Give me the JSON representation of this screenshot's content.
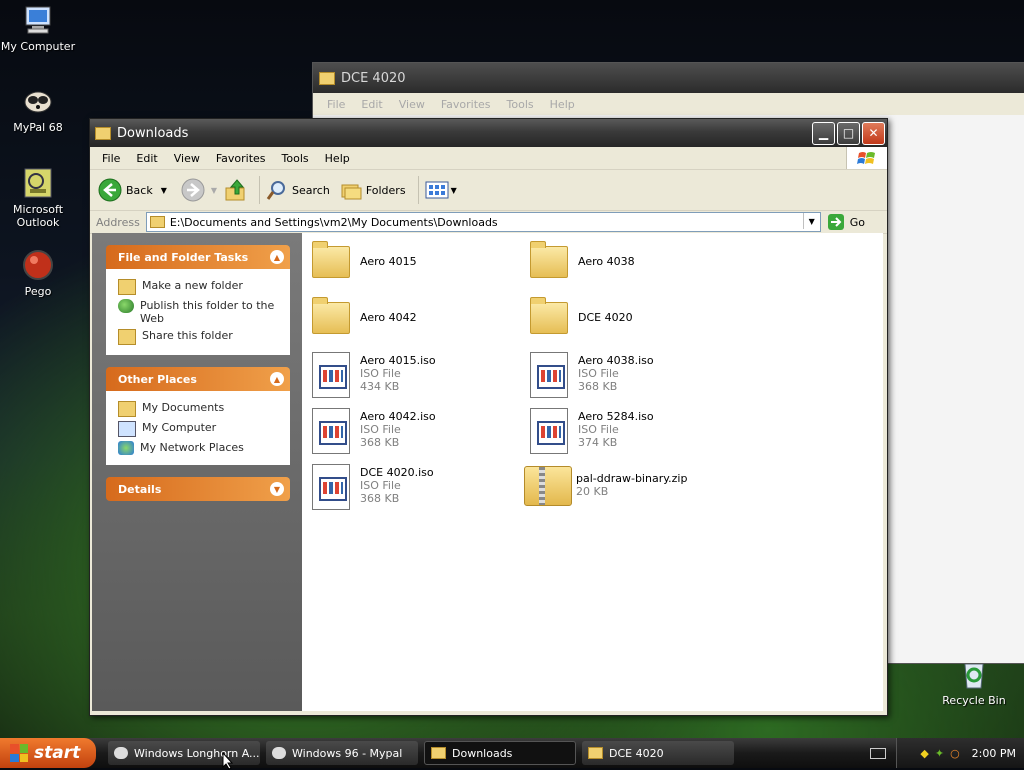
{
  "desktop": {
    "icons": [
      {
        "label": "My Computer"
      },
      {
        "label": "MyPal 68"
      },
      {
        "label": "Microsoft Outlook"
      },
      {
        "label": "Pego"
      },
      {
        "label": "Recycle Bin"
      }
    ]
  },
  "back_window": {
    "title": "DCE 4020",
    "menu": [
      "File",
      "Edit",
      "View",
      "Favorites",
      "Tools",
      "Help"
    ]
  },
  "window": {
    "title": "Downloads",
    "menu": [
      "File",
      "Edit",
      "View",
      "Favorites",
      "Tools",
      "Help"
    ],
    "toolbar": {
      "back": "Back",
      "search": "Search",
      "folders": "Folders"
    },
    "address": {
      "label": "Address",
      "value": "E:\\Documents and Settings\\vm2\\My Documents\\Downloads",
      "go": "Go"
    },
    "tasks": {
      "title": "File and Folder Tasks",
      "items": [
        "Make a new folder",
        "Publish this folder to the Web",
        "Share this folder"
      ]
    },
    "other_places": {
      "title": "Other Places",
      "items": [
        "My Documents",
        "My Computer",
        "My Network Places"
      ]
    },
    "details": {
      "title": "Details"
    },
    "files": [
      {
        "name": "Aero 4015",
        "kind": "folder"
      },
      {
        "name": "Aero 4038",
        "kind": "folder"
      },
      {
        "name": "Aero 4042",
        "kind": "folder"
      },
      {
        "name": "DCE 4020",
        "kind": "folder"
      },
      {
        "name": "Aero 4015.iso",
        "type": "ISO File",
        "size": "434 KB",
        "kind": "iso"
      },
      {
        "name": "Aero 4038.iso",
        "type": "ISO File",
        "size": "368 KB",
        "kind": "iso"
      },
      {
        "name": "Aero 4042.iso",
        "type": "ISO File",
        "size": "368 KB",
        "kind": "iso"
      },
      {
        "name": "Aero 5284.iso",
        "type": "ISO File",
        "size": "374 KB",
        "kind": "iso"
      },
      {
        "name": "DCE 4020.iso",
        "type": "ISO File",
        "size": "368 KB",
        "kind": "iso"
      },
      {
        "name": "pal-ddraw-binary.zip",
        "size": "20 KB",
        "kind": "zip"
      }
    ]
  },
  "taskbar": {
    "start": "start",
    "tasks": [
      "Windows Longhorn A...",
      "Windows 96 - Mypal",
      "Downloads",
      "DCE 4020"
    ],
    "clock": "2:00 PM"
  }
}
